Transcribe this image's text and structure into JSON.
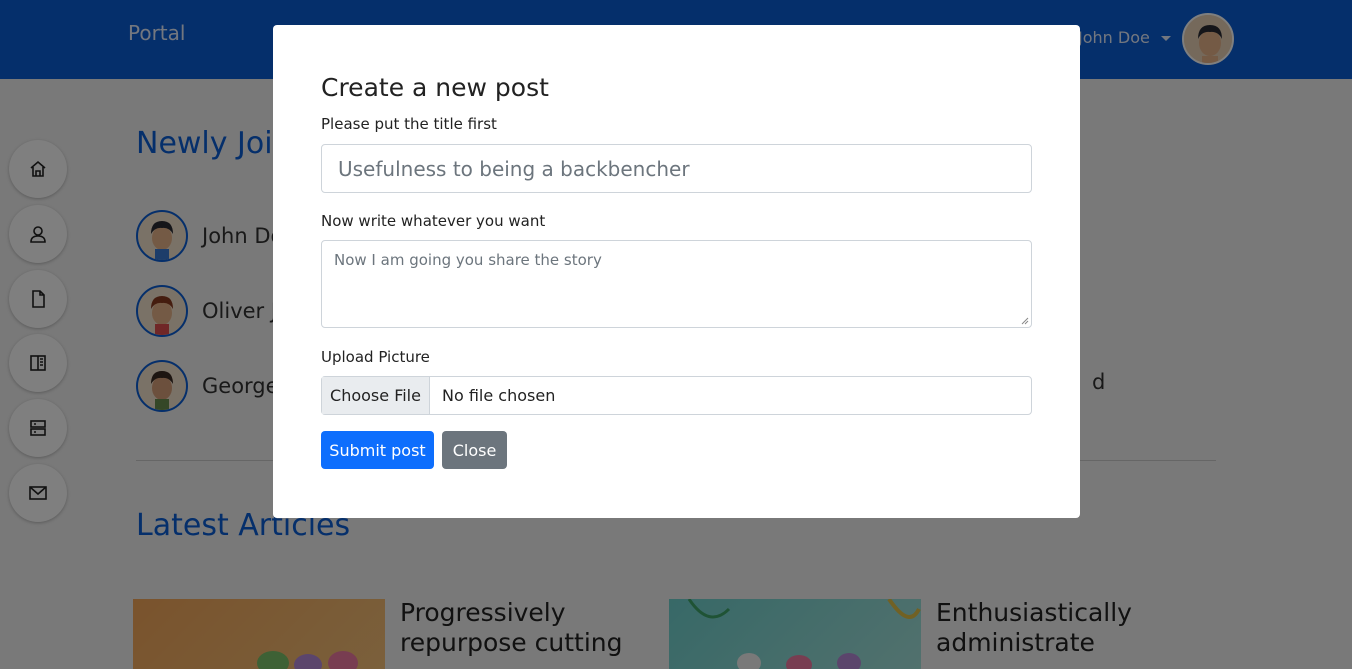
{
  "navbar": {
    "brand": "Portal",
    "user_name": "John Doe"
  },
  "sidebar": {
    "items": [
      {
        "icon": "home-icon"
      },
      {
        "icon": "user-icon"
      },
      {
        "icon": "document-icon"
      },
      {
        "icon": "book-icon"
      },
      {
        "icon": "server-icon"
      },
      {
        "icon": "mail-icon"
      }
    ]
  },
  "sections": {
    "newly_joined": "Newly Joined",
    "latest_articles": "Latest Articles"
  },
  "members": [
    {
      "name": "John Doe"
    },
    {
      "name": "Oliver J"
    },
    {
      "name": "George"
    }
  ],
  "members_right_fragment": "d",
  "articles": [
    {
      "title": "Progressively repurpose cutting"
    },
    {
      "title": "Enthusiastically administrate"
    }
  ],
  "modal": {
    "title": "Create a new post",
    "title_label": "Please put the title first",
    "title_placeholder": "Usefulness to being a backbencher",
    "body_label": "Now write whatever you want",
    "body_placeholder": "Now I am going you share the story",
    "upload_label": "Upload Picture",
    "choose_file": "Choose File",
    "no_file": "No file chosen",
    "submit": "Submit post",
    "close": "Close"
  },
  "colors": {
    "primary": "#0b5ed7",
    "secondary": "#6c757d",
    "overlay": "rgba(0,0,0,0.5)"
  }
}
